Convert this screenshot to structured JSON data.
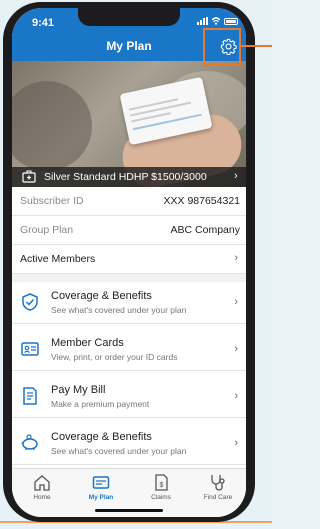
{
  "status": {
    "time": "9:41"
  },
  "header": {
    "title": "My Plan"
  },
  "plan": {
    "name": "Silver Standard HDHP $1500/3000"
  },
  "details": [
    {
      "label": "Subscriber ID",
      "value": "XXX 987654321"
    },
    {
      "label": "Group Plan",
      "value": "ABC Company"
    }
  ],
  "active_members": {
    "label": "Active Members"
  },
  "menu": [
    {
      "title": "Coverage & Benefits",
      "subtitle": "See what's covered under your plan",
      "icon": "shield-check-icon"
    },
    {
      "title": "Member Cards",
      "subtitle": "View, print, or order your ID cards",
      "icon": "id-card-icon"
    },
    {
      "title": "Pay My Bill",
      "subtitle": "Make a premium payment",
      "icon": "bill-icon"
    },
    {
      "title": "Coverage & Benefits",
      "subtitle": "See what's covered under your plan",
      "icon": "piggy-bank-icon"
    }
  ],
  "nav": [
    {
      "label": "Home",
      "icon": "home-icon"
    },
    {
      "label": "My Plan",
      "icon": "id-card-icon",
      "active": true
    },
    {
      "label": "Claims",
      "icon": "claims-icon"
    },
    {
      "label": "Find Care",
      "icon": "stethoscope-icon"
    }
  ],
  "colors": {
    "brand": "#1a76c6",
    "callout": "#e8782e"
  }
}
